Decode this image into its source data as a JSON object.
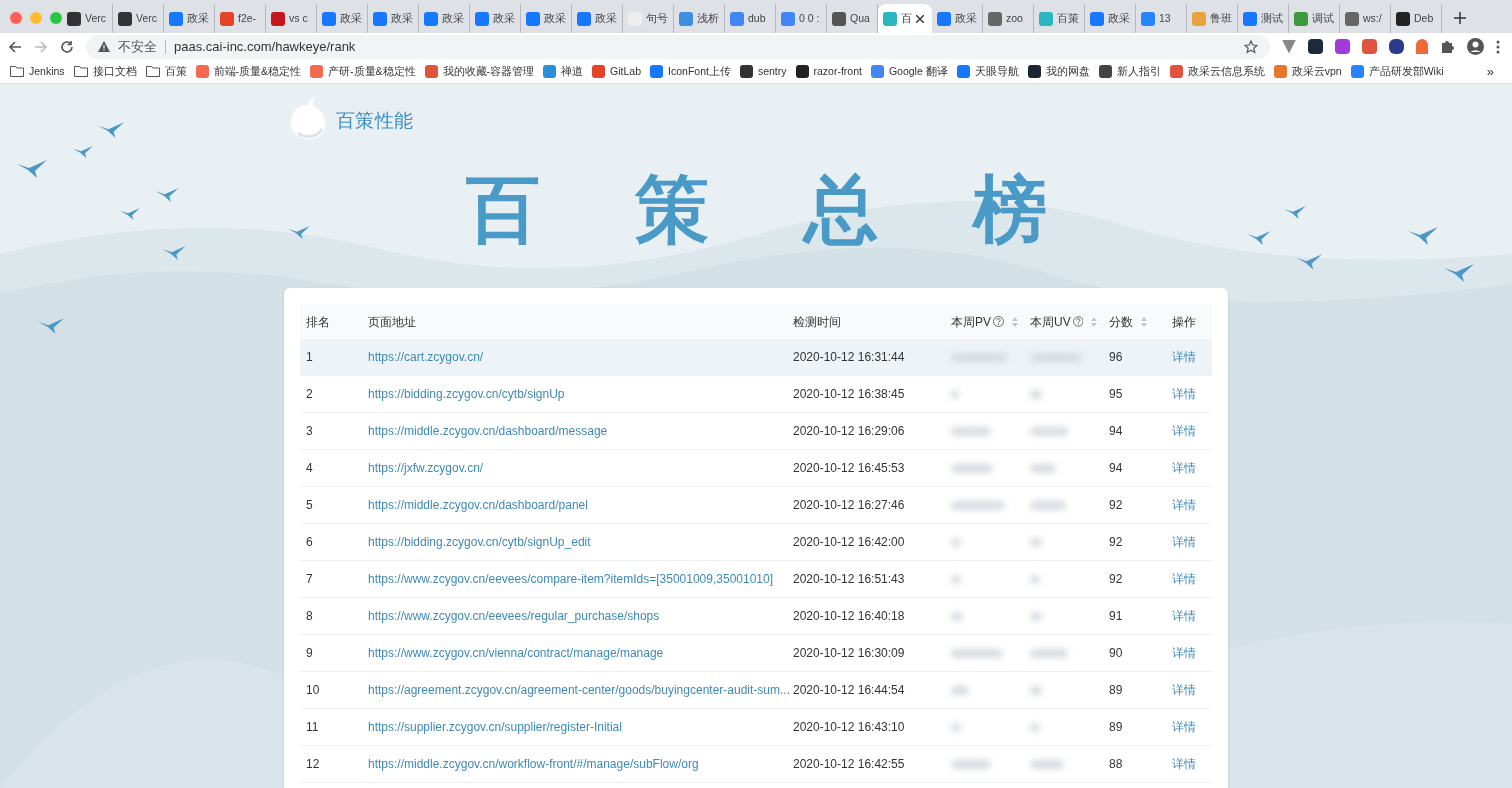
{
  "tabs": [
    {
      "title": "Verc",
      "color": "#333333",
      "selected": false
    },
    {
      "title": "Verc",
      "color": "#333333",
      "selected": false
    },
    {
      "title": "政采",
      "color": "#1677ff",
      "selected": false
    },
    {
      "title": "f2e-",
      "color": "#e24329",
      "selected": false
    },
    {
      "title": "vs c",
      "color": "#c4161c",
      "selected": false
    },
    {
      "title": "政采",
      "color": "#1677ff",
      "selected": false
    },
    {
      "title": "政采",
      "color": "#1677ff",
      "selected": false
    },
    {
      "title": "政采",
      "color": "#1677ff",
      "selected": false
    },
    {
      "title": "政采",
      "color": "#1677ff",
      "selected": false
    },
    {
      "title": "政采",
      "color": "#1677ff",
      "selected": false
    },
    {
      "title": "政采",
      "color": "#1677ff",
      "selected": false
    },
    {
      "title": "句号",
      "color": "#eeeeee",
      "selected": false
    },
    {
      "title": "浅析",
      "color": "#3d8fe0",
      "selected": false
    },
    {
      "title": "dub",
      "color": "#4285f4",
      "selected": false
    },
    {
      "title": "0 0 :",
      "color": "#4285f4",
      "selected": false
    },
    {
      "title": "Qua",
      "color": "#555555",
      "selected": false
    },
    {
      "title": "百",
      "color": "#2bb6c2",
      "selected": true
    },
    {
      "title": "政采",
      "color": "#1677ff",
      "selected": false
    },
    {
      "title": "zoo",
      "color": "#666666",
      "selected": false
    },
    {
      "title": "百策",
      "color": "#2bb6c2",
      "selected": false
    },
    {
      "title": "政采",
      "color": "#1677ff",
      "selected": false
    },
    {
      "title": "13",
      "color": "#2684ff",
      "selected": false
    },
    {
      "title": "鲁班",
      "color": "#e8a33d",
      "selected": false
    },
    {
      "title": "测试",
      "color": "#1677ff",
      "selected": false
    },
    {
      "title": "调试",
      "color": "#3c9a3c",
      "selected": false
    },
    {
      "title": "ws:/",
      "color": "#666666",
      "selected": false
    },
    {
      "title": "Deb",
      "color": "#222222",
      "selected": false
    }
  ],
  "address_bar": {
    "security": "不安全",
    "url": "paas.cai-inc.com/hawkeye/rank"
  },
  "bookmarks": [
    {
      "kind": "folder",
      "label": "Jenkins"
    },
    {
      "kind": "folder",
      "label": "接口文档"
    },
    {
      "kind": "folder",
      "label": "百策"
    },
    {
      "kind": "link",
      "label": "前端-质量&稳定性",
      "color": "#f26b4f"
    },
    {
      "kind": "link",
      "label": "产研-质量&稳定性",
      "color": "#f26b4f"
    },
    {
      "kind": "link",
      "label": "我的收藏-容器管理",
      "color": "#e0533e"
    },
    {
      "kind": "link",
      "label": "禅道",
      "color": "#2a8fd8"
    },
    {
      "kind": "link",
      "label": "GitLab",
      "color": "#e24329"
    },
    {
      "kind": "link",
      "label": "IconFont上传",
      "color": "#1677ff"
    },
    {
      "kind": "link",
      "label": "sentry",
      "color": "#333333"
    },
    {
      "kind": "link",
      "label": "razor-front",
      "color": "#222222"
    },
    {
      "kind": "link",
      "label": "Google 翻译",
      "color": "#4285f4"
    },
    {
      "kind": "link",
      "label": "天眼导航",
      "color": "#1677ff"
    },
    {
      "kind": "link",
      "label": "我的网盘",
      "color": "#1d2433"
    },
    {
      "kind": "link",
      "label": "新人指引",
      "color": "#444444"
    },
    {
      "kind": "link",
      "label": "政采云信息系统",
      "color": "#e0533e"
    },
    {
      "kind": "link",
      "label": "政采云vpn",
      "color": "#e8772e"
    },
    {
      "kind": "link",
      "label": "产品研发部Wiki",
      "color": "#2684ff"
    }
  ],
  "bookmarks_more": "»",
  "birds": [
    {
      "kind": "bird"
    }
  ],
  "logo_text": "百策性能",
  "page_title": "百策总榜",
  "table": {
    "columns": [
      {
        "label": "排名",
        "sortable": false,
        "help": false
      },
      {
        "label": "页面地址",
        "sortable": false,
        "help": false
      },
      {
        "label": "检测时间",
        "sortable": false,
        "help": false
      },
      {
        "label": "本周PV",
        "sortable": true,
        "help": true
      },
      {
        "label": "本周UV",
        "sortable": true,
        "help": true
      },
      {
        "label": "分数",
        "sortable": true,
        "help": false
      },
      {
        "label": "操作",
        "sortable": false,
        "help": false
      }
    ],
    "rows": [
      {
        "rank": "1",
        "url": "https://cart.zcygov.cn/",
        "time": "2020-10-12 16:31:44",
        "score": "96",
        "action": "详情",
        "hovered": true
      },
      {
        "rank": "2",
        "url": "https://bidding.zcygov.cn/cytb/signUp",
        "time": "2020-10-12 16:38:45",
        "score": "95",
        "action": "详情",
        "hovered": false
      },
      {
        "rank": "3",
        "url": "https://middle.zcygov.cn/dashboard/message",
        "time": "2020-10-12 16:29:06",
        "score": "94",
        "action": "详情",
        "hovered": false
      },
      {
        "rank": "4",
        "url": "https://jxfw.zcygov.cn/",
        "time": "2020-10-12 16:45:53",
        "score": "94",
        "action": "详情",
        "hovered": false
      },
      {
        "rank": "5",
        "url": "https://middle.zcygov.cn/dashboard/panel",
        "time": "2020-10-12 16:27:46",
        "score": "92",
        "action": "详情",
        "hovered": false
      },
      {
        "rank": "6",
        "url": "https://bidding.zcygov.cn/cytb/signUp_edit",
        "time": "2020-10-12 16:42:00",
        "score": "92",
        "action": "详情",
        "hovered": false
      },
      {
        "rank": "7",
        "url": "https://www.zcygov.cn/eevees/compare-item?itemIds=[35001009,35001010]",
        "time": "2020-10-12 16:51:43",
        "score": "92",
        "action": "详情",
        "hovered": false
      },
      {
        "rank": "8",
        "url": "https://www.zcygov.cn/eevees/regular_purchase/shops",
        "time": "2020-10-12 16:40:18",
        "score": "91",
        "action": "详情",
        "hovered": false
      },
      {
        "rank": "9",
        "url": "https://www.zcygov.cn/vienna/contract/manage/manage",
        "time": "2020-10-12 16:30:09",
        "score": "90",
        "action": "详情",
        "hovered": false
      },
      {
        "rank": "10",
        "url": "https://agreement.zcygov.cn/agreement-center/goods/buyingcenter-audit-sum...",
        "time": "2020-10-12 16:44:54",
        "score": "89",
        "action": "详情",
        "hovered": false
      },
      {
        "rank": "11",
        "url": "https://supplier.zcygov.cn/supplier/register-Initial",
        "time": "2020-10-12 16:43:10",
        "score": "89",
        "action": "详情",
        "hovered": false
      },
      {
        "rank": "12",
        "url": "https://middle.zcygov.cn/workflow-front/#/manage/subFlow/org",
        "time": "2020-10-12 16:42:55",
        "score": "88",
        "action": "详情",
        "hovered": false
      }
    ]
  }
}
